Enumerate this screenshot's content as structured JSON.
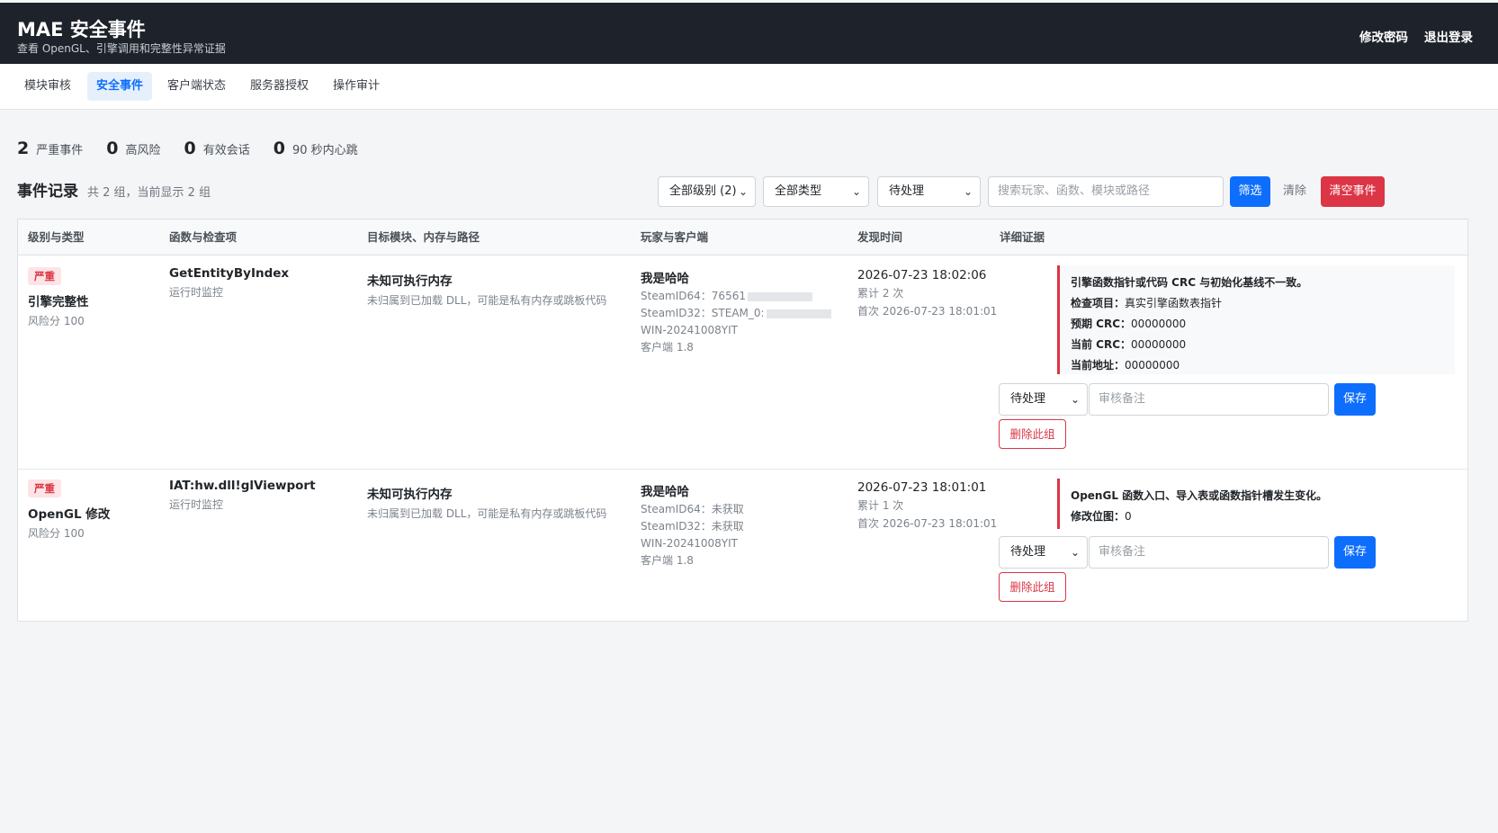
{
  "header": {
    "title": "MAE 安全事件",
    "subtitle": "查看 OpenGL、引擎调用和完整性异常证据",
    "change_password": "修改密码",
    "logout": "退出登录"
  },
  "tabs": [
    {
      "label": "模块审核"
    },
    {
      "label": "安全事件"
    },
    {
      "label": "客户端状态"
    },
    {
      "label": "服务器授权"
    },
    {
      "label": "操作审计"
    }
  ],
  "stats": [
    {
      "value": "2",
      "label": "严重事件"
    },
    {
      "value": "0",
      "label": "高风险"
    },
    {
      "value": "0",
      "label": "有效会话"
    },
    {
      "value": "0",
      "label": "90 秒内心跳"
    }
  ],
  "records": {
    "title": "事件记录",
    "summary": "共 2 组，当前显示 2 组"
  },
  "filters": {
    "level": "全部级别 (2)",
    "type": "全部类型",
    "status": "待处理",
    "search_placeholder": "搜索玩家、函数、模块或路径",
    "filter_button": "筛选",
    "clear_button": "清除",
    "clear_events_button": "清空事件"
  },
  "table": {
    "headers": [
      "级别与类型",
      "函数与检查项",
      "目标模块、内存与路径",
      "玩家与客户端",
      "发现时间",
      "详细证据"
    ],
    "rows": [
      {
        "severity": "严重",
        "type": "引擎完整性",
        "risk": "风险分 100",
        "function": "GetEntityByIndex",
        "check": "运行时监控",
        "target": "未知可执行内存",
        "target_desc": "未归属到已加载 DLL，可能是私有内存或跳板代码",
        "player": "我是哈哈",
        "steam64": "SteamID64：76561",
        "steam32": "SteamID32：STEAM_0:",
        "machine": "WIN-20241008YIT",
        "client": "客户端 1.8",
        "time": "2026-07-23 18:02:06",
        "count": "累计 2 次",
        "first": "首次 2026-07-23 18:01:01",
        "evidence_title": "引擎函数指针或代码 CRC 与初始化基线不一致。",
        "evidence": [
          {
            "k": "检查项目：",
            "v": "真实引擎函数表指针"
          },
          {
            "k": "预期 CRC：",
            "v": "00000000"
          },
          {
            "k": "当前 CRC：",
            "v": "00000000"
          },
          {
            "k": "当前地址：",
            "v": "00000000"
          }
        ],
        "status": "待处理",
        "note_placeholder": "审核备注",
        "save": "保存",
        "delete": "删除此组"
      },
      {
        "severity": "严重",
        "type": "OpenGL 修改",
        "risk": "风险分 100",
        "function": "IAT:hw.dll!glViewport",
        "check": "运行时监控",
        "target": "未知可执行内存",
        "target_desc": "未归属到已加载 DLL，可能是私有内存或跳板代码",
        "player": "我是哈哈",
        "steam64": "SteamID64：未获取",
        "steam32": "SteamID32：未获取",
        "machine": "WIN-20241008YIT",
        "client": "客户端 1.8",
        "time": "2026-07-23 18:01:01",
        "count": "累计 1 次",
        "first": "首次 2026-07-23 18:01:01",
        "evidence_title": "OpenGL 函数入口、导入表或函数指针槽发生变化。",
        "evidence": [
          {
            "k": "修改位图：",
            "v": "0"
          }
        ],
        "status": "待处理",
        "note_placeholder": "审核备注",
        "save": "保存",
        "delete": "删除此组"
      }
    ]
  },
  "colors": {
    "topbar": "#1e232b",
    "primary": "#0d6efd",
    "danger": "#dc3545"
  }
}
